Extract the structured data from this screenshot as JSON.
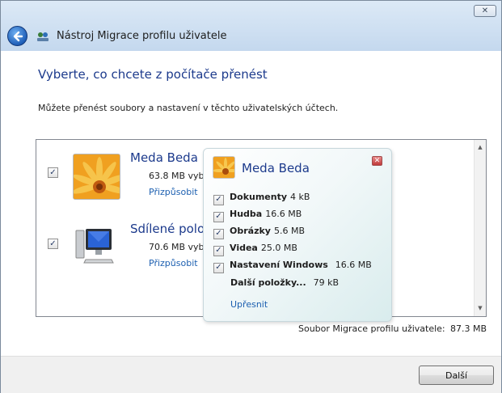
{
  "window": {
    "title": "Nástroj Migrace profilu uživatele",
    "close_glyph": "✕"
  },
  "page": {
    "heading": "Vyberte, co chcete z počítače přenést",
    "intro": "Můžete přenést soubory a nastavení v těchto uživatelských účtech."
  },
  "accounts": [
    {
      "name": "Meda Beda",
      "size": "63.8 MB vybráno",
      "link": "Přizpůsobit",
      "checked": true,
      "icon": "flower-user-picture-icon"
    },
    {
      "name": "Sdílené položky",
      "size": "70.6 MB vybráno",
      "link": "Přizpůsobit",
      "checked": true,
      "icon": "computer-icon"
    }
  ],
  "popup": {
    "title": "Meda Beda",
    "items": [
      {
        "label": "Dokumenty",
        "size": "4 kB",
        "checked": true
      },
      {
        "label": "Hudba",
        "size": "16.6 MB",
        "checked": true
      },
      {
        "label": "Obrázky",
        "size": "5.6 MB",
        "checked": true
      },
      {
        "label": "Videa",
        "size": "25.0 MB",
        "checked": true
      },
      {
        "label": "Nastavení Windows",
        "size": "16.6 MB",
        "checked": true
      }
    ],
    "more": {
      "label": "Další položky...",
      "size": "79 kB"
    },
    "refine_link": "Upřesnit"
  },
  "summary": {
    "label": "Soubor Migrace profilu uživatele:",
    "value": "87.3 MB"
  },
  "footer": {
    "next_label": "Další"
  },
  "colors": {
    "heading": "#1c3a8c",
    "link": "#1c5fb0",
    "titlebar": "#cfe0f2"
  }
}
